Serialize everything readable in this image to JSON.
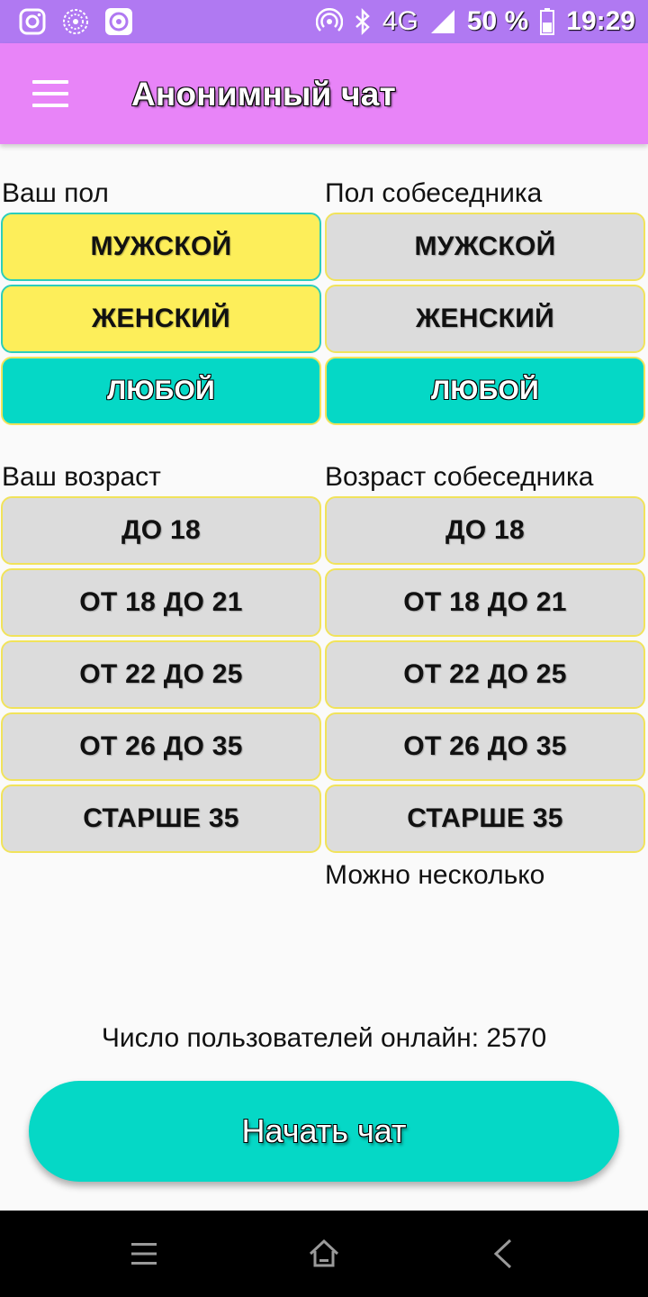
{
  "status_bar": {
    "network": "4G",
    "network_small": "4G",
    "battery": "50 %",
    "time": "19:29",
    "left_icons": [
      "instagram-icon",
      "flower-icon",
      "music-app-icon"
    ],
    "right_icons": [
      "hotspot-icon",
      "bluetooth-icon",
      "signal-icon",
      "battery-icon"
    ]
  },
  "app_bar": {
    "menu_icon": "hamburger-menu-icon",
    "title": "Анонимный чат"
  },
  "gender": {
    "own_label": "Ваш пол",
    "partner_label": "Пол собеседника",
    "own_options": [
      {
        "label": "МУЖСКОЙ",
        "state": "yellow"
      },
      {
        "label": "ЖЕНСКИЙ",
        "state": "yellow"
      },
      {
        "label": "ЛЮБОЙ",
        "state": "teal"
      }
    ],
    "partner_options": [
      {
        "label": "МУЖСКОЙ",
        "state": "grey"
      },
      {
        "label": "ЖЕНСКИЙ",
        "state": "grey"
      },
      {
        "label": "ЛЮБОЙ",
        "state": "teal"
      }
    ]
  },
  "age": {
    "own_label": "Ваш возраст",
    "partner_label": "Возраст собеседника",
    "own_options": [
      "ДО 18",
      "ОТ 18 ДО 21",
      "ОТ 22 ДО 25",
      "ОТ 26 ДО 35",
      "СТАРШЕ 35"
    ],
    "partner_options": [
      "ДО 18",
      "ОТ 18 ДО 21",
      "ОТ 22 ДО 25",
      "ОТ 26 ДО 35",
      "СТАРШЕ 35"
    ],
    "partner_hint": "Можно несколько"
  },
  "online_text": "Число пользователей онлайн: 2570",
  "start_button": "Начать чат",
  "colors": {
    "status_bar": "#b079f2",
    "app_bar": "#e884f8",
    "selected_yellow": "#fdee5a",
    "selected_teal": "#05d8c6",
    "unselected": "#dcdcdc"
  },
  "nav_bar": [
    "menu-lines-icon",
    "home-icon",
    "back-icon"
  ]
}
